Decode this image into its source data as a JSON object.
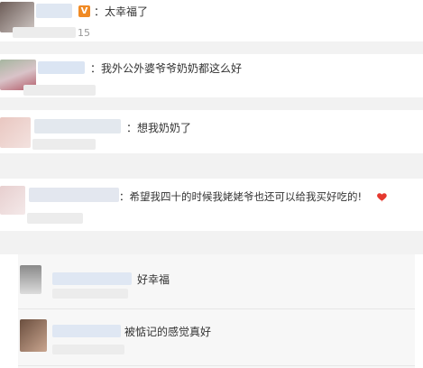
{
  "comments": [
    {
      "text": "：太幸福了",
      "time_fragment": "15",
      "badge_glyph": "V"
    },
    {
      "text": "：我外公外婆爷爷奶奶都这么好"
    },
    {
      "text": "：想我奶奶了"
    },
    {
      "text": "：希望我四十的时候我姥姥爷也还可以给我买好吃的!"
    }
  ],
  "replies": [
    {
      "text": "好幸福"
    },
    {
      "text": "被惦记的感觉真好"
    }
  ],
  "icons": {
    "vip": "verified-badge-icon",
    "heart": "heart-icon"
  },
  "colors": {
    "background": "#ffffff",
    "band": "#f2f2f2",
    "reply_bg": "#f7f7f7",
    "badge": "#f08a24",
    "heart": "#e5392f"
  }
}
